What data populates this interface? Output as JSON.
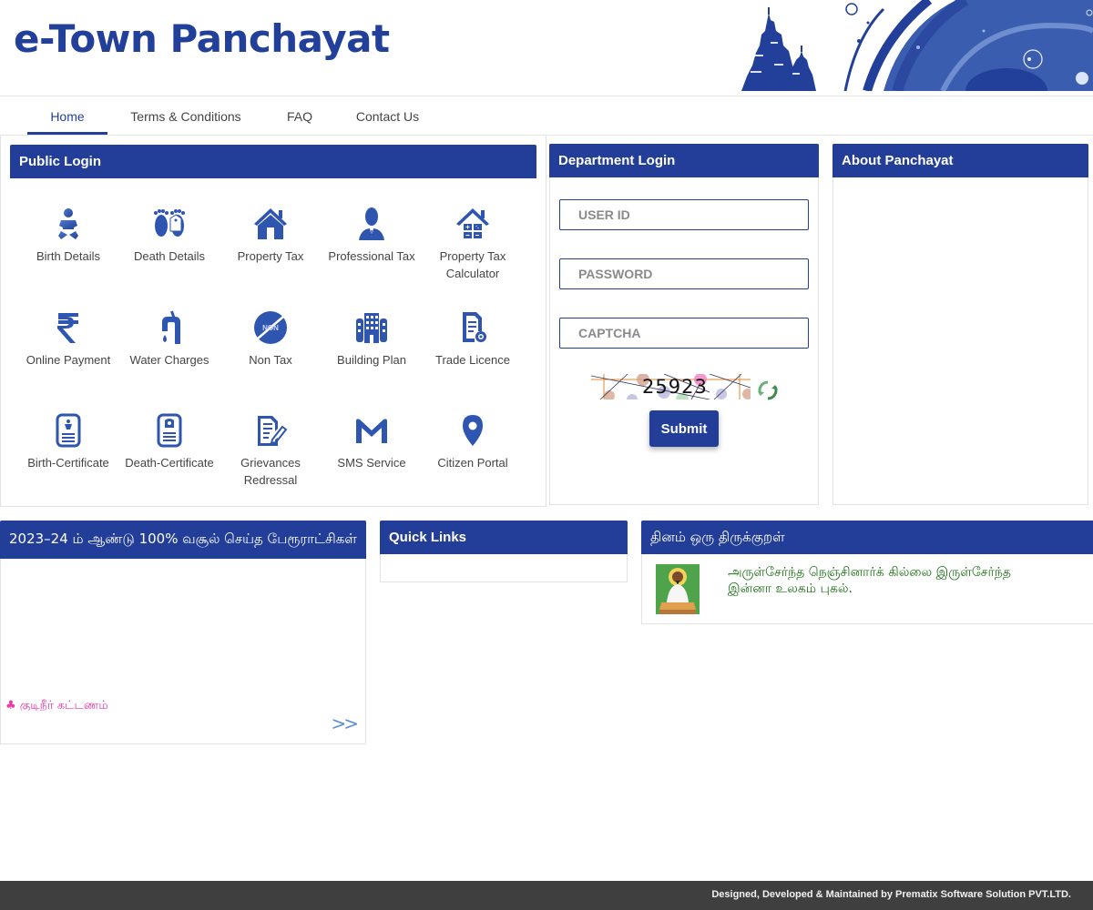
{
  "header": {
    "title": "e-Town Panchayat",
    "banner_image": "temple-banner"
  },
  "nav": {
    "items": [
      {
        "label": "Home",
        "active": true
      },
      {
        "label": "Terms & Conditions",
        "active": false
      },
      {
        "label": "FAQ",
        "active": false
      },
      {
        "label": "Contact Us",
        "active": false
      }
    ]
  },
  "public_login": {
    "title": "Public Login",
    "services": [
      {
        "label": "Birth Details",
        "icon": "baby-icon"
      },
      {
        "label": "Death Details",
        "icon": "footprints-tag-icon"
      },
      {
        "label": "Property Tax",
        "icon": "house-icon"
      },
      {
        "label": "Professional Tax",
        "icon": "professional-person-icon"
      },
      {
        "label": "Property Tax Calculator",
        "icon": "house-calculator-icon"
      },
      {
        "label": "Online Payment",
        "icon": "rupee-icon"
      },
      {
        "label": "Water Charges",
        "icon": "water-tap-icon"
      },
      {
        "label": "Non Tax",
        "icon": "non-tax-icon"
      },
      {
        "label": "Building Plan",
        "icon": "building-icon"
      },
      {
        "label": "Trade Licence",
        "icon": "licence-document-icon"
      },
      {
        "label": "Birth-Certificate",
        "icon": "birth-certificate-icon"
      },
      {
        "label": "Death-Certificate",
        "icon": "death-certificate-icon"
      },
      {
        "label": "Grievances Redressal",
        "icon": "grievance-document-icon"
      },
      {
        "label": "SMS Service",
        "icon": "sms-m-icon"
      },
      {
        "label": "Citizen Portal",
        "icon": "location-pin-icon"
      }
    ]
  },
  "department_login": {
    "title": "Department Login",
    "user_id_placeholder": "USER ID",
    "password_placeholder": "PASSWORD",
    "captcha_placeholder": "CAPTCHA",
    "captcha_code": "25923",
    "submit_label": "Submit"
  },
  "about": {
    "title": "About Panchayat"
  },
  "collection": {
    "title": "2023–24 ம் ஆண்டு 100% வசூல் செய்த பேரூராட்சிகள்",
    "marquee_text": "♣ குடிநீர் கட்டணம்",
    "more_label": ">>"
  },
  "quick_links": {
    "title": "Quick Links"
  },
  "thirukkural": {
    "title": "தினம் ஒரு திருக்குறள்",
    "line1": "அருள்சேர்ந்த நெஞ்சினார்க் கில்லை இருள்சேர்ந்த",
    "line2": "இன்னா உலகம் புகல்."
  },
  "footer": {
    "text": "Designed, Developed & Maintained by Prematix Software Solution PVT.LTD."
  },
  "colors": {
    "primary": "#223e98",
    "footer_bg": "#3f3f3f",
    "kural_text": "#1a6f14",
    "marquee_text": "#e83aa8"
  }
}
